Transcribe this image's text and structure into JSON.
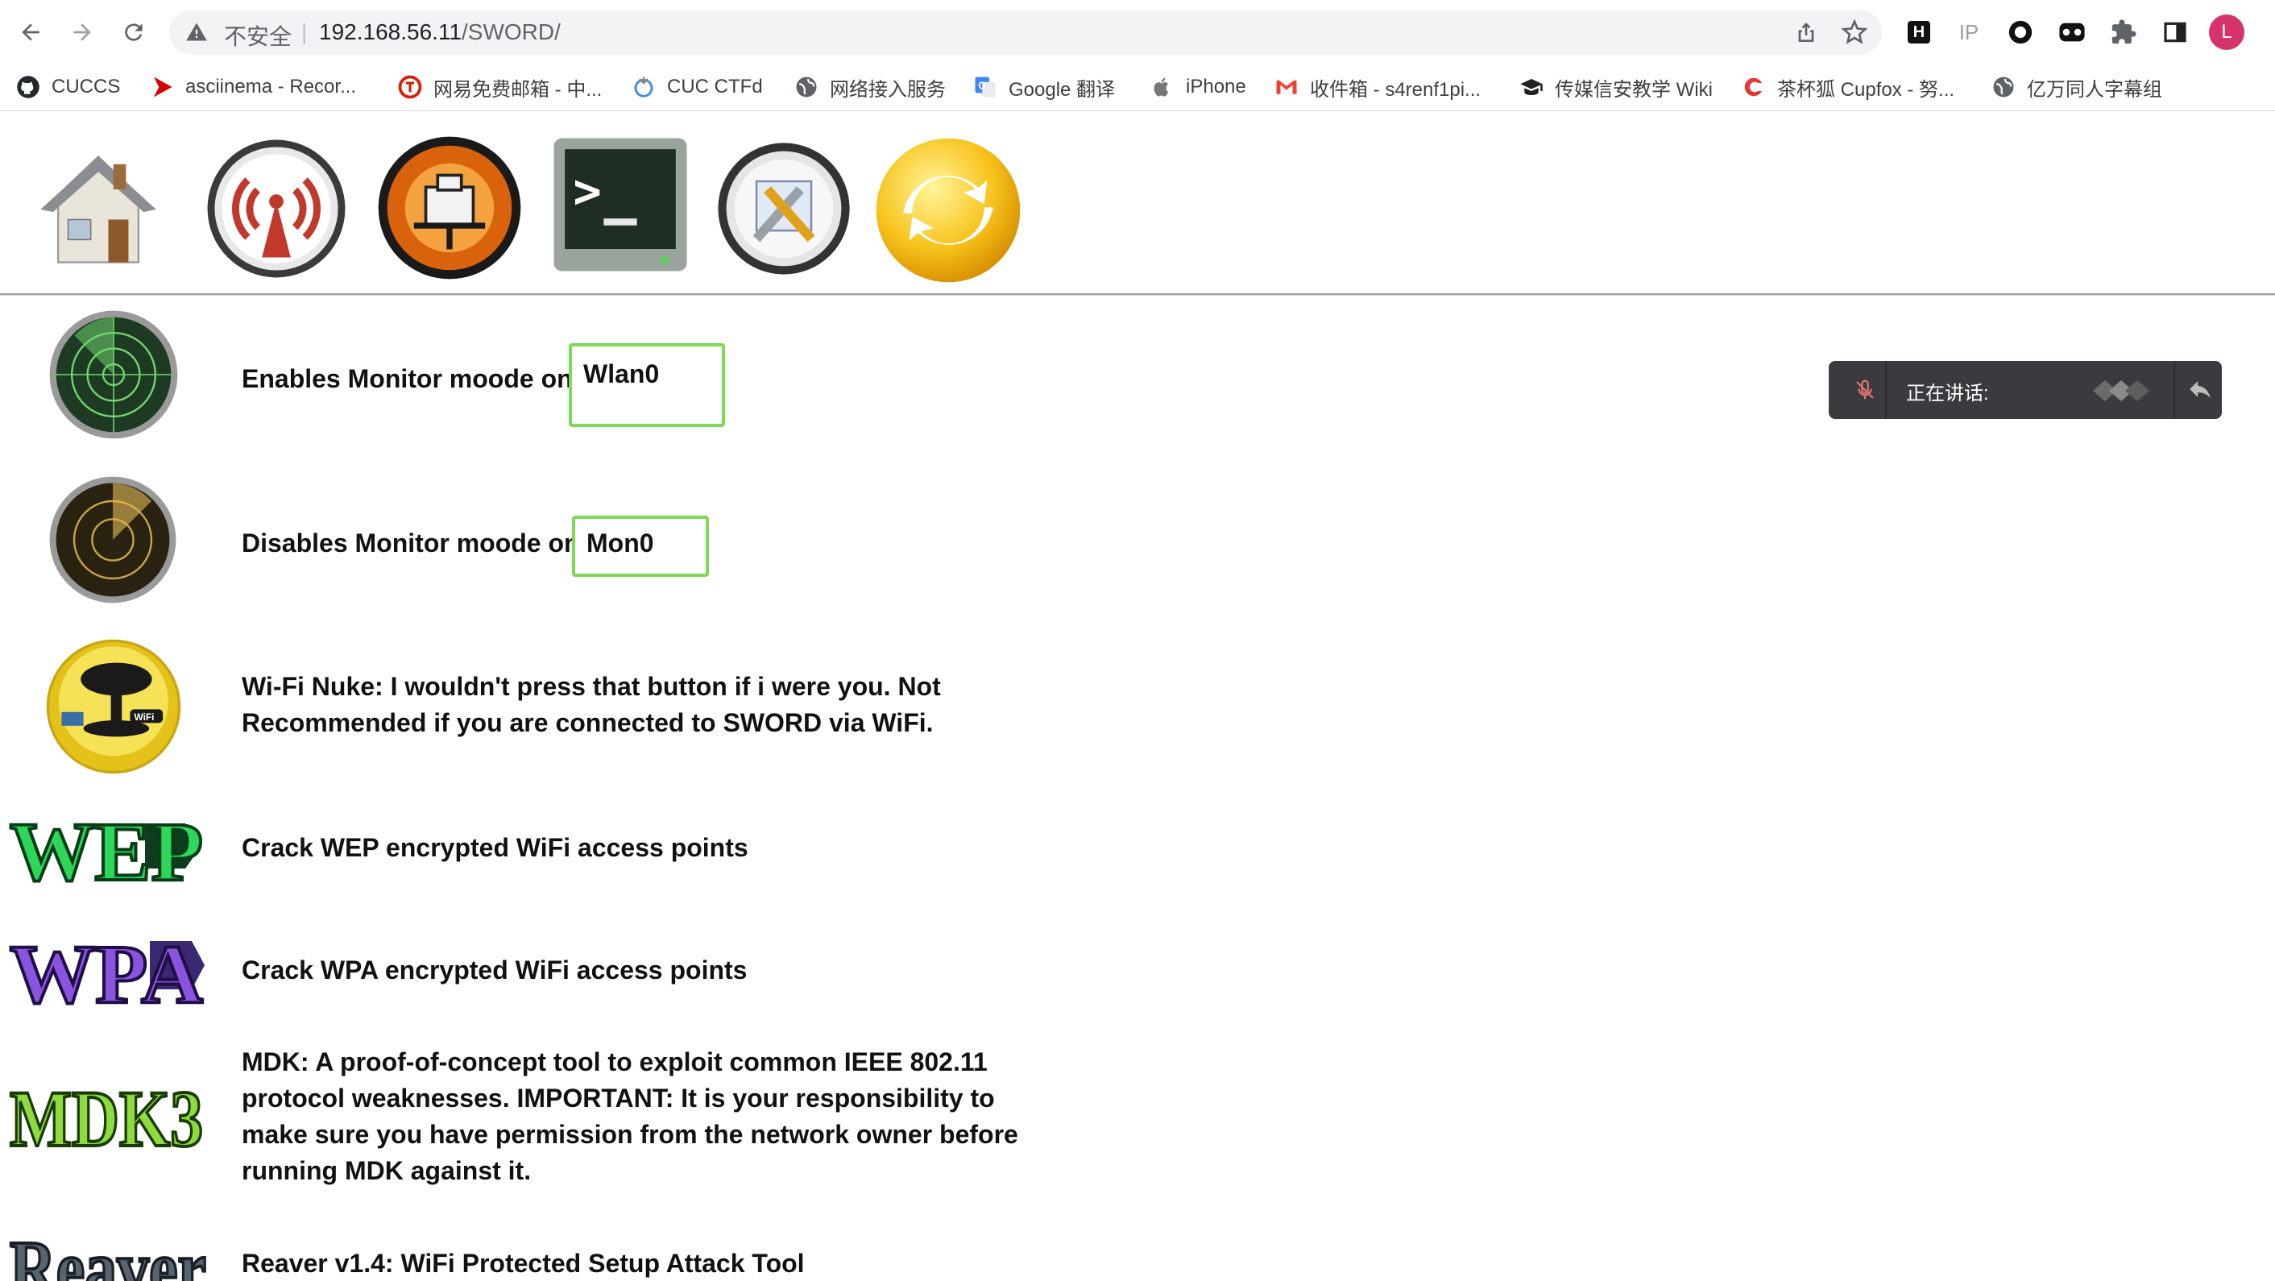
{
  "browser": {
    "security_label": "不安全",
    "separator": "|",
    "url_host": "192.168.56.11",
    "url_path": "/SWORD/",
    "profile_initial": "L",
    "extensions": [
      "H",
      "IP"
    ]
  },
  "bookmarks": [
    {
      "label": "CUCCS",
      "icon": "github-icon"
    },
    {
      "label": "asciinema - Recor...",
      "icon": "asciinema-icon"
    },
    {
      "label": "网易免费邮箱 - 中...",
      "icon": "netease-icon"
    },
    {
      "label": "CUC CTFd",
      "icon": "ctfd-icon"
    },
    {
      "label": "网络接入服务",
      "icon": "globe-icon"
    },
    {
      "label": "Google 翻译",
      "icon": "google-translate-icon"
    },
    {
      "label": "iPhone",
      "icon": "apple-icon"
    },
    {
      "label": "收件箱 - s4renf1pi...",
      "icon": "gmail-icon"
    },
    {
      "label": "传媒信安教学 Wiki",
      "icon": "graduation-cap-icon"
    },
    {
      "label": "茶杯狐 Cupfox - 努...",
      "icon": "cupfox-icon"
    },
    {
      "label": "亿万同人字幕组",
      "icon": "globe-icon"
    }
  ],
  "top_icons": [
    "home-icon",
    "wifi-tower-icon",
    "ethernet-icon",
    "terminal-icon",
    "tools-icon",
    "refresh-icon"
  ],
  "rows": {
    "monitor_on": {
      "text": "Enables Monitor moode on",
      "iface": "Wlan0"
    },
    "monitor_off": {
      "text": "Disables Monitor moode on",
      "iface": "Mon0"
    },
    "nuke": {
      "text": "Wi-Fi Nuke: I wouldn't press that button if i were you. Not Recommended if you are connected to SWORD via WiFi.",
      "badge": "WiFi"
    },
    "wep": {
      "text": "Crack WEP encrypted WiFi access points",
      "logo": "WEP"
    },
    "wpa": {
      "text": "Crack WPA encrypted WiFi access points",
      "logo": "WPA"
    },
    "mdk": {
      "text": "MDK: A proof-of-concept tool to exploit common IEEE 802.11 protocol weaknesses. IMPORTANT: It is your responsibility to make sure you have permission from the network owner before running MDK against it.",
      "logo": "MDK3"
    },
    "reaver": {
      "text": "Reaver v1.4: WiFi Protected Setup Attack Tool",
      "logo": "Reaver"
    }
  },
  "speaking_bubble": {
    "label": "正在讲话:"
  }
}
